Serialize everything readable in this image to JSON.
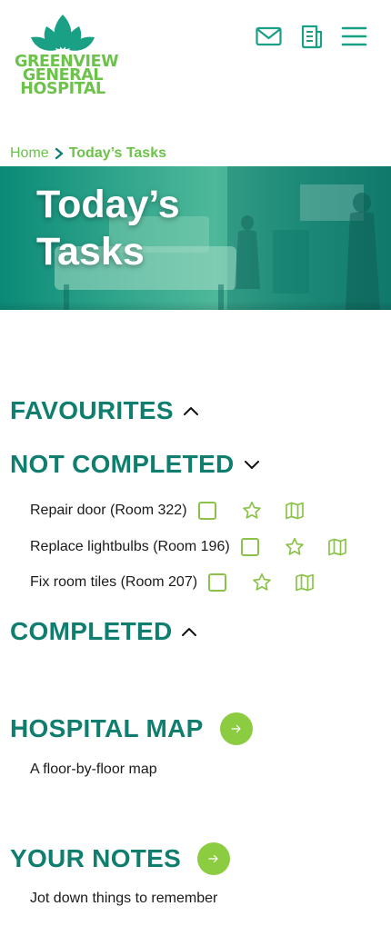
{
  "brand": {
    "logo_lines": [
      "GREENVIEW",
      "GENERAL",
      "HOSPITAL"
    ],
    "green": "#6cc24a",
    "teal": "#0f7e6e"
  },
  "header_icons": [
    "mail-icon",
    "notes-icon",
    "menu-icon"
  ],
  "breadcrumb": {
    "home": "Home",
    "current": "Today’s Tasks"
  },
  "hero": {
    "title": "Today’s Tasks"
  },
  "sections": {
    "favourites": {
      "title": "FAVOURITES",
      "state": "collapsed"
    },
    "not_completed": {
      "title": "NOT COMPLETED",
      "state": "expanded"
    },
    "completed": {
      "title": "COMPLETED",
      "state": "collapsed"
    }
  },
  "tasks": [
    {
      "label": "Repair door (Room 322)",
      "checked": false
    },
    {
      "label": "Replace lightbulbs (Room 196)",
      "checked": false
    },
    {
      "label": "Fix room tiles (Room 207)",
      "checked": false
    }
  ],
  "links": {
    "map": {
      "title": "HOSPITAL MAP",
      "desc": "A floor-by-floor map"
    },
    "notes": {
      "title": "YOUR NOTES",
      "desc": "Jot down things to remember"
    }
  }
}
